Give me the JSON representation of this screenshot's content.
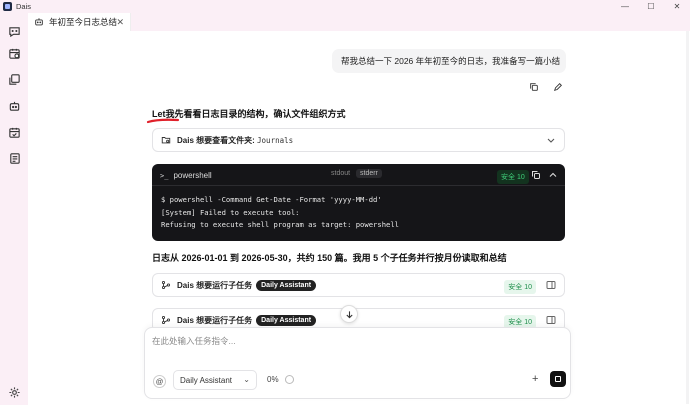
{
  "app": {
    "name": "Dais"
  },
  "window": {
    "minimize": "—",
    "maximize": "☐",
    "close": "✕"
  },
  "rail": {
    "icons": [
      "message-icon",
      "calendar-icon",
      "layers-icon",
      "bot-icon",
      "calendar-check-icon",
      "document-list-icon",
      "settings-icon"
    ]
  },
  "tab": {
    "label": "年初至今日志总结",
    "close": "✕"
  },
  "chat": {
    "user_message": "帮我总结一下 2026 年年初至今的日志，我准备写一篇小结",
    "ai_line_1": "Let我先看看日志目录的结构，确认文件组织方式",
    "folder_card": {
      "text": "Dais 想要查看文件夹:",
      "path": "Journals"
    },
    "terminal": {
      "title": "powershell",
      "prompt_glyph": ">_",
      "stdout": "stdout",
      "stderr": "stderr",
      "safety": "安全 10",
      "lines": [
        "$ powershell -Command Get-Date -Format 'yyyy-MM-dd'",
        "[System] Failed to execute tool:",
        "Refusing to execute shell program as target: powershell"
      ]
    },
    "ai_line_2": "日志从 2026-01-01 到 2026-05-30，共约 150 篇。我用 5 个子任务并行按月份读取和总结",
    "subtask_cards": [
      {
        "text": "Dais 想要运行子任务",
        "agent": "Daily Assistant",
        "safety": "安全 10"
      },
      {
        "text": "Dais 想要运行子任务",
        "agent": "Daily Assistant",
        "safety": "安全 10"
      }
    ]
  },
  "composer": {
    "placeholder": "在此处输入任务指令...",
    "value": "",
    "at": "@",
    "agent": "Daily Assistant",
    "context_pct": "0%",
    "plus": "+"
  },
  "colors": {
    "accent_green": "#1e8f4b",
    "terminal_bg": "#151518",
    "sidebar_bg": "#fbeff6",
    "annotation_red": "#e0202a"
  }
}
